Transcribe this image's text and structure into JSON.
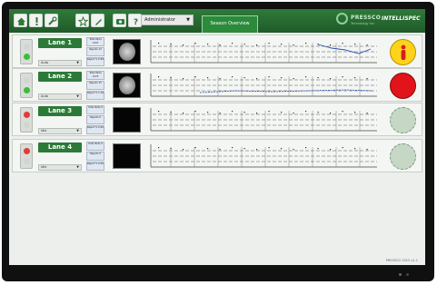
{
  "nav": {
    "buttons": [
      {
        "icon": "home-icon"
      },
      {
        "icon": "alert-icon"
      },
      {
        "icon": "wrench-icon"
      },
      {
        "icon": "star-icon"
      },
      {
        "icon": "pencil-icon"
      },
      {
        "icon": "camera-icon"
      },
      {
        "icon": "help-icon"
      }
    ],
    "role_label": "Administrator",
    "view_tab_label": "Season Overview"
  },
  "brand": {
    "name": "PRESSCO",
    "tagline": "Technology Inc.",
    "product": "INTELLISPEC"
  },
  "lanes": [
    {
      "title": "Lane 1",
      "mode": "Auto",
      "stats": [
        "Total Parts 1347",
        "Rejects 12",
        "Reject % 0.89"
      ],
      "light": {
        "top": "#d0d6d0",
        "bottom": "#38c038"
      },
      "thumb": "product",
      "status": "yellow",
      "status_color": "#ffd31a",
      "trend_color": "#2a4fb0"
    },
    {
      "title": "Lane 2",
      "mode": "Auto",
      "stats": [
        "Total Parts 1270",
        "Rejects 15",
        "Reject % 1.18"
      ],
      "light": {
        "top": "#d0d6d0",
        "bottom": "#38c038"
      },
      "thumb": "product",
      "status": "red",
      "status_color": "#e0141a",
      "trend_color": "#2a4fb0"
    },
    {
      "title": "Lane 3",
      "mode": "Idle",
      "stats": [
        "Total Parts 0",
        "Rejects 0",
        "Reject % 0.00"
      ],
      "light": {
        "top": "#e23a3a",
        "bottom": "#d0d6d0"
      },
      "thumb": "empty",
      "status": "gray",
      "status_color": "#c6d7c6",
      "trend_color": "#2a4fb0"
    },
    {
      "title": "Lane 4",
      "mode": "Idle",
      "stats": [
        "Total Parts 0",
        "Rejects 0",
        "Reject % 0.00"
      ],
      "light": {
        "top": "#e23a3a",
        "bottom": "#d0d6d0"
      },
      "thumb": "empty",
      "status": "gray",
      "status_color": "#c6d7c6",
      "trend_color": "#2a4fb0"
    }
  ],
  "footer": {
    "text": "PRESSCO 2013 v1.1"
  }
}
